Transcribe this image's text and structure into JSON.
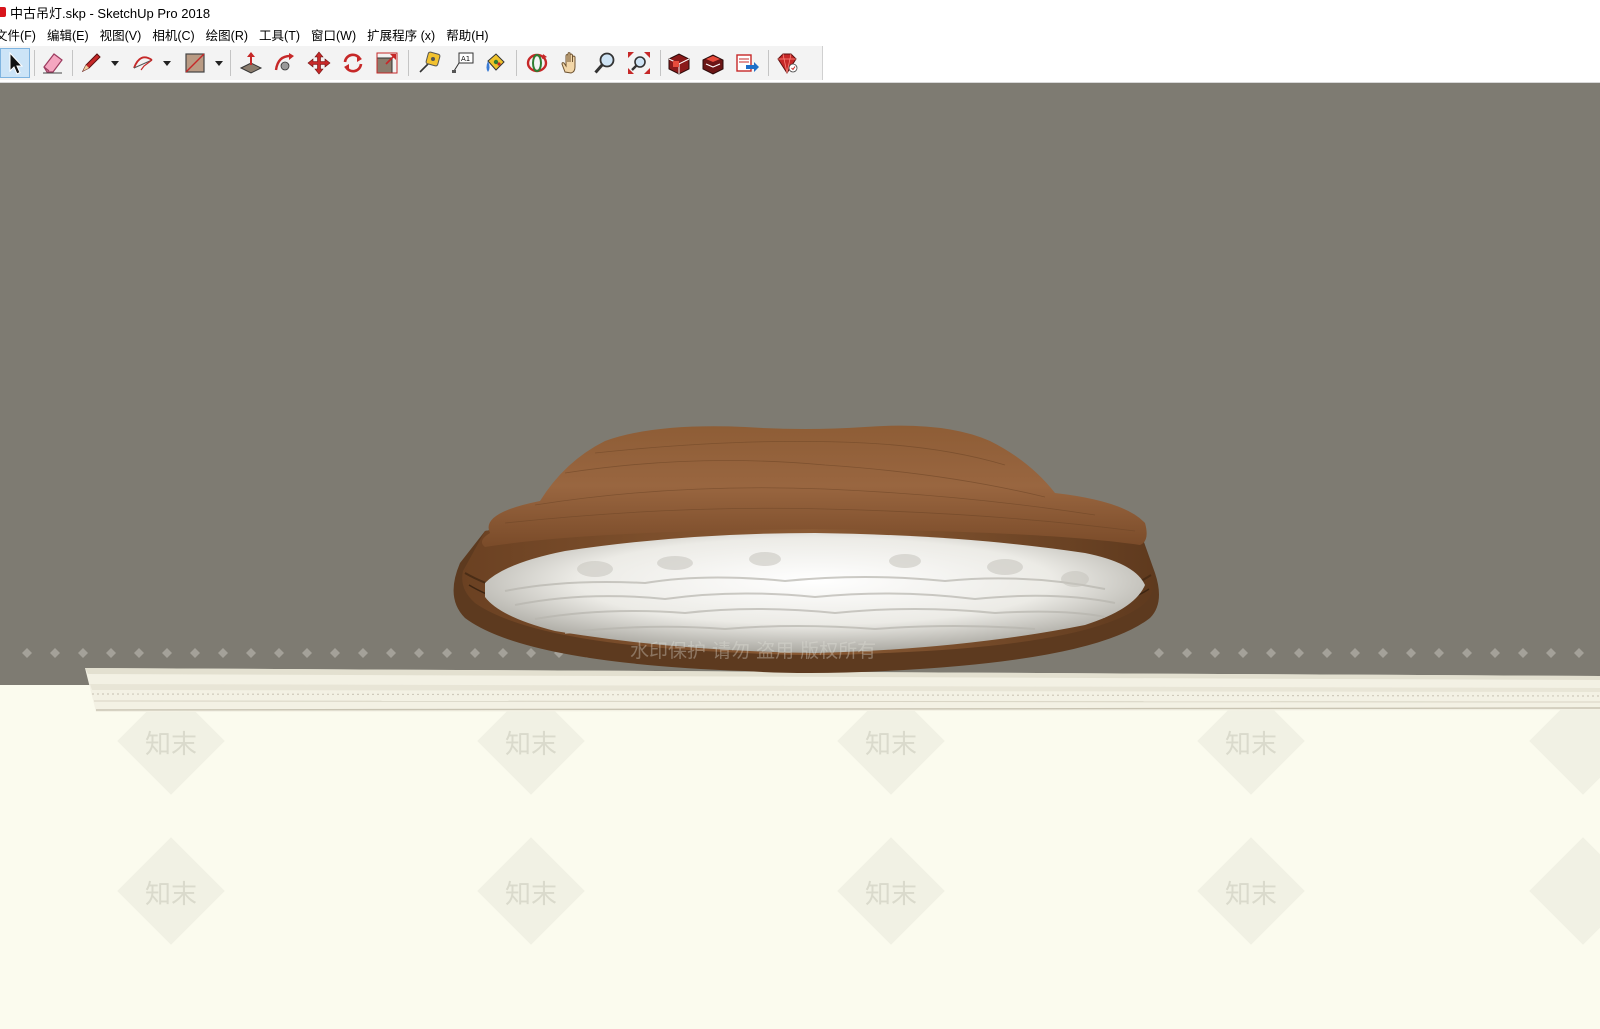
{
  "window": {
    "title": "中古吊灯.skp - SketchUp Pro 2018"
  },
  "menu": [
    {
      "label": "文件(F)"
    },
    {
      "label": "编辑(E)"
    },
    {
      "label": "视图(V)"
    },
    {
      "label": "相机(C)"
    },
    {
      "label": "绘图(R)"
    },
    {
      "label": "工具(T)"
    },
    {
      "label": "窗口(W)"
    },
    {
      "label": "扩展程序 (x)"
    },
    {
      "label": "帮助(H)"
    }
  ],
  "toolbar": {
    "tools": [
      {
        "name": "select-tool",
        "icon": "arrow-cursor-icon",
        "selected": true
      },
      {
        "name": "eraser-tool",
        "icon": "eraser-icon"
      },
      {
        "name": "line-tool",
        "icon": "pencil-icon"
      },
      {
        "name": "arc-tool",
        "icon": "arc-icon"
      },
      {
        "name": "rectangle-tool",
        "icon": "rectangle-icon"
      },
      {
        "name": "push-pull-tool",
        "icon": "push-pull-icon"
      },
      {
        "name": "follow-me-tool",
        "icon": "follow-me-icon"
      },
      {
        "name": "move-tool",
        "icon": "move-arrows-icon"
      },
      {
        "name": "rotate-tool",
        "icon": "rotate-icon"
      },
      {
        "name": "scale-tool",
        "icon": "scale-icon"
      },
      {
        "name": "tape-measure-tool",
        "icon": "tape-measure-icon"
      },
      {
        "name": "text-tool",
        "icon": "text-a1-icon"
      },
      {
        "name": "paint-bucket-tool",
        "icon": "paint-bucket-icon"
      },
      {
        "name": "orbit-tool",
        "icon": "orbit-icon"
      },
      {
        "name": "pan-tool",
        "icon": "hand-icon"
      },
      {
        "name": "zoom-tool",
        "icon": "magnifier-icon"
      },
      {
        "name": "zoom-extents-tool",
        "icon": "zoom-extents-icon"
      },
      {
        "name": "3d-warehouse-button",
        "icon": "warehouse-icon"
      },
      {
        "name": "extension-warehouse-button",
        "icon": "extension-warehouse-icon"
      },
      {
        "name": "layout-send-button",
        "icon": "send-to-layout-icon"
      },
      {
        "name": "ruby-console-button",
        "icon": "ruby-gem-icon"
      }
    ]
  },
  "viewport": {
    "watermark_text": "水印保护 请勿 盗用 版权所有",
    "brand_mark": "知末",
    "colors": {
      "sky": "#7e7b72",
      "ground": "#fbfbee",
      "wood": "#8b5a35",
      "shade": "#e9e7e1"
    }
  }
}
